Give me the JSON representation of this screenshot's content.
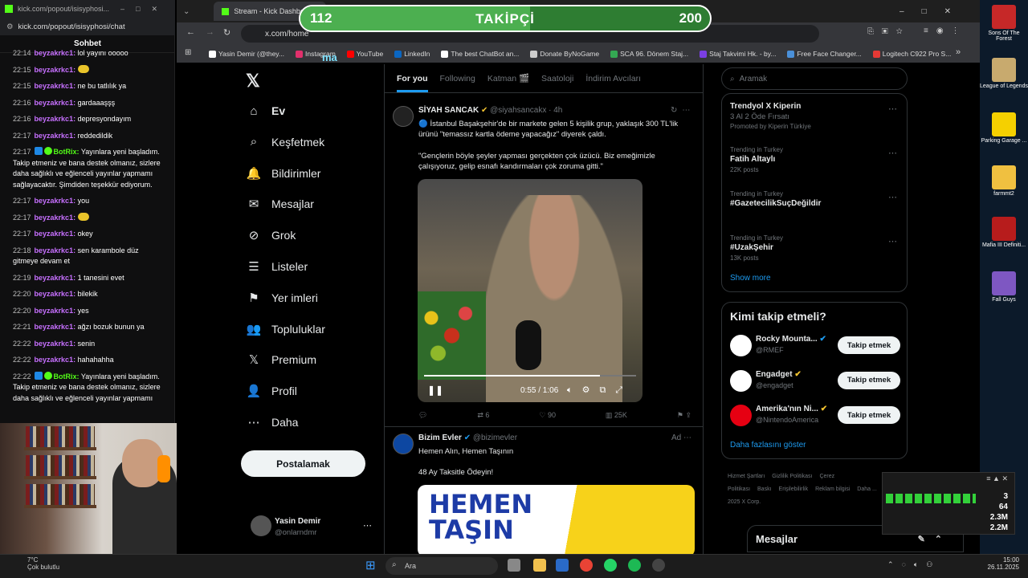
{
  "chat": {
    "window_title": "kick.com/popout/isisyphosi...",
    "url": "kick.com/popout/isisyphosi/chat",
    "header": "Sohbet",
    "messages": [
      {
        "time": "22:14",
        "user": "beyzakrkc1:",
        "text": "lol yayını ooooo",
        "bot": false
      },
      {
        "time": "22:15",
        "user": "beyzakrkc1:",
        "text": "",
        "bot": false
      },
      {
        "time": "22:15",
        "user": "beyzakrkc1:",
        "text": "ne bu tatlılık ya",
        "bot": false
      },
      {
        "time": "22:16",
        "user": "beyzakrkc1:",
        "text": "gardaaaşşş",
        "bot": false
      },
      {
        "time": "22:16",
        "user": "beyzakrkc1:",
        "text": "depresyondayım",
        "bot": false
      },
      {
        "time": "22:17",
        "user": "beyzakrkc1:",
        "text": "reddedildik",
        "bot": false
      },
      {
        "time": "22:17",
        "user": "BotRix:",
        "text": "Yayınlara yeni başladım. Takip etmeniz ve bana destek olmanız, sizlere daha sağlıklı ve eğlenceli yayınlar yapmamı sağlayacaktır. Şimdiden teşekkür ediyorum.",
        "bot": true
      },
      {
        "time": "22:17",
        "user": "beyzakrkc1:",
        "text": "you",
        "bot": false
      },
      {
        "time": "22:17",
        "user": "beyzakrkc1:",
        "text": "",
        "bot": false
      },
      {
        "time": "22:17",
        "user": "beyzakrkc1:",
        "text": "okey",
        "bot": false
      },
      {
        "time": "22:18",
        "user": "beyzakrkc1:",
        "text": "sen karambole düz gitmeye devam et",
        "bot": false
      },
      {
        "time": "22:19",
        "user": "beyzakrkc1:",
        "text": "1 tanesini evet",
        "bot": false
      },
      {
        "time": "22:20",
        "user": "beyzakrkc1:",
        "text": "bilekik",
        "bot": false
      },
      {
        "time": "22:20",
        "user": "beyzakrkc1:",
        "text": "yes",
        "bot": false
      },
      {
        "time": "22:21",
        "user": "beyzakrkc1:",
        "text": "ağzı bozuk bunun ya",
        "bot": false
      },
      {
        "time": "22:22",
        "user": "beyzakrkc1:",
        "text": "senin",
        "bot": false
      },
      {
        "time": "22:22",
        "user": "beyzakrkc1:",
        "text": "hahahahha",
        "bot": false
      },
      {
        "time": "22:22",
        "user": "BotRix:",
        "text": "Yayınlara yeni başladım. Takip etmeniz ve bana destek olmanız, sizlere daha sağlıklı ve eğlenceli yayınlar yapmamı",
        "bot": true
      }
    ]
  },
  "browser": {
    "tab_title": "Stream - Kick Dashboard",
    "url": "x.com/home",
    "bookmarks": [
      "Yasin Demir (@they...",
      "Instagram",
      "YouTube",
      "LinkedIn",
      "The best ChatBot an...",
      "Donate ByNoGame",
      "SCA 96. Dönem Staj...",
      "Staj Takvimi Hk. - by...",
      "Free Face Changer...",
      "Logitech C922 Pro S..."
    ],
    "bookmark_colors": [
      "#ffffff",
      "#e1306c",
      "#ff0000",
      "#0a66c2",
      "#ffffff",
      "#cccccc",
      "#34a853",
      "#7b3fe4",
      "#4a90d9",
      "#e53935"
    ]
  },
  "follower_goal": {
    "current": "112",
    "label": "TAKİPÇİ",
    "goal": "200",
    "progress": 0.56,
    "overlay_text": "ma"
  },
  "x": {
    "nav": [
      {
        "label": "Ev",
        "icon": "home-icon",
        "glyph": "⌂",
        "active": true
      },
      {
        "label": "Keşfetmek",
        "icon": "search-icon",
        "glyph": "⌕"
      },
      {
        "label": "Bildirimler",
        "icon": "bell-icon",
        "glyph": "🔔"
      },
      {
        "label": "Mesajlar",
        "icon": "mail-icon",
        "glyph": "✉"
      },
      {
        "label": "Grok",
        "icon": "grok-icon",
        "glyph": "⊘"
      },
      {
        "label": "Listeler",
        "icon": "list-icon",
        "glyph": "☰"
      },
      {
        "label": "Yer imleri",
        "icon": "bookmark-icon",
        "glyph": "⚑"
      },
      {
        "label": "Topluluklar",
        "icon": "communities-icon",
        "glyph": "👥"
      },
      {
        "label": "Premium",
        "icon": "x-premium-icon",
        "glyph": "𝕏"
      },
      {
        "label": "Profil",
        "icon": "profile-icon",
        "glyph": "👤"
      },
      {
        "label": "Daha",
        "icon": "more-icon",
        "glyph": "⋯"
      }
    ],
    "post_button": "Postalamak",
    "account": {
      "name": "Yasin Demir",
      "handle": "@onlarndmr"
    },
    "tabs": [
      "For you",
      "Following",
      "Katman 🎬",
      "Saatoloji",
      "İndirim Avcıları"
    ],
    "tweet": {
      "name": "SİYAH SANCAK",
      "handle": "@siyahsancakx · 4h",
      "text1": "🔵 İstanbul Başakşehir'de bir markete gelen 5 kişilik grup, yaklaşık 300 TL'lik ürünü \"temassız kartla ödeme yapacağız\" diyerek çaldı.",
      "text2": "\"Gençlerin böyle şeyler yapması gerçekten çok üzücü. Biz emeğimizle çalışıyoruz, gelip esnafı kandırmaları çok zoruma gitti.\"",
      "video_time": "0:55 / 1:06",
      "video_progress": 0.83,
      "retweets": "6",
      "likes": "90",
      "views": "25K"
    },
    "ad": {
      "name": "Bizim Evler",
      "handle": "@bizimevler",
      "tag": "Ad",
      "line1": "Hemen Alın, Hemen Taşının",
      "line2": "48 Ay Taksitle Ödeyin!",
      "banner1": "HEMEN",
      "banner2": "TAŞIN"
    },
    "search_placeholder": "Aramak",
    "trends": [
      {
        "top": "Trendyol X Kiperin",
        "sub": "3 Al 2 Öde Fırsatı",
        "meta": "Promoted by Kiperin Türkiye"
      },
      {
        "top": "Trending in Turkey",
        "sub": "Fatih Altaylı",
        "meta": "22K posts"
      },
      {
        "top": "Trending in Turkey",
        "sub": "#GazetecilikSuçDeğildir",
        "meta": ""
      },
      {
        "top": "Trending in Turkey",
        "sub": "#UzakŞehir",
        "meta": "13K posts"
      }
    ],
    "show_more": "Show more",
    "who_title": "Kimi takip etmeli?",
    "who": [
      {
        "name": "Rocky Mounta...",
        "handle": "@RMEF",
        "btn": "Takip etmek",
        "color": "#ffffff"
      },
      {
        "name": "Engadget",
        "handle": "@engadget",
        "btn": "Takip etmek",
        "color": "#ffffff"
      },
      {
        "name": "Amerika'nın Ni...",
        "handle": "@NintendoAmerica",
        "btn": "Takip etmek",
        "color": "#e60012"
      }
    ],
    "who_more": "Daha fazlasını göster",
    "footer": [
      "Hizmet Şartları",
      "Gizlilik Politikası",
      "Çerez Politikası",
      "Baskı",
      "Erişilebilirlik",
      "Reklam bilgisi",
      "Daha ...",
      "© 2025 X Corp."
    ],
    "messages_bar": "Mesajlar"
  },
  "desktop": [
    {
      "label": "Sons Of The Forest",
      "color": "#c62828"
    },
    {
      "label": "League of Legends",
      "color": "#c8aa6e"
    },
    {
      "label": "Parking Garage ...",
      "color": "#f5d000"
    },
    {
      "label": "farmmt2",
      "color": "#f0c040"
    },
    {
      "label": "Mafia III Definiti...",
      "color": "#b71c1c"
    },
    {
      "label": "Fall Guys",
      "color": "#7e57c2"
    }
  ],
  "meter": {
    "values": [
      "3",
      "64",
      "2.3M",
      "2.2M"
    ]
  },
  "taskbar": {
    "weather": "7°C",
    "weather_desc": "Çok bulutlu",
    "search": "Ara",
    "time": "15:00",
    "date": "26.11.2025"
  }
}
